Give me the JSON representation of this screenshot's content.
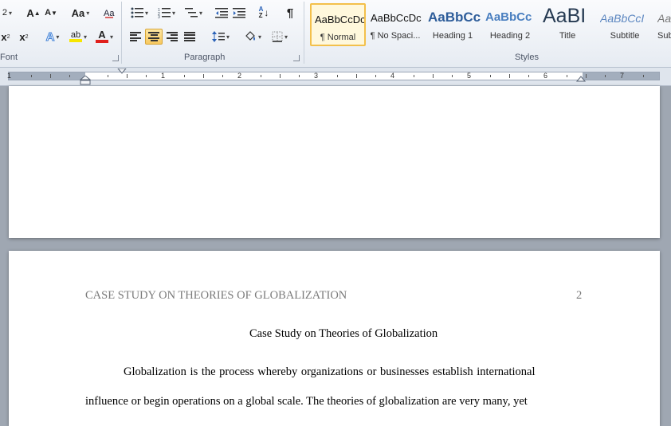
{
  "ribbon": {
    "font_group": {
      "label": "Font",
      "size_value": "2",
      "grow_font": "A",
      "shrink_font": "A",
      "change_case": "Aa",
      "subscript": "x",
      "superscript": "x",
      "font_color_letter": "A",
      "highlight_letters": "ab",
      "text_effects_letter": "A"
    },
    "paragraph_group": {
      "label": "Paragraph",
      "pilcrow": "¶",
      "sort_top": "A",
      "sort_bottom": "Z"
    },
    "styles_group": {
      "label": "Styles",
      "styles": [
        {
          "sample": "AaBbCcDc",
          "name": "¶ Normal",
          "selected": true
        },
        {
          "sample": "AaBbCcDc",
          "name": "¶ No Spaci...",
          "selected": false
        },
        {
          "sample": "AaBbCc",
          "name": "Heading 1",
          "selected": false
        },
        {
          "sample": "AaBbCc",
          "name": "Heading 2",
          "selected": false
        },
        {
          "sample": "AaBI",
          "name": "Title",
          "selected": false
        },
        {
          "sample": "AaBbCcI",
          "name": "Subtitle",
          "selected": false
        },
        {
          "sample": "Aa",
          "name": "Sub",
          "selected": false
        }
      ]
    }
  },
  "ruler": {
    "numbers": [
      "1",
      "1",
      "2",
      "3",
      "4",
      "5",
      "6",
      "7"
    ]
  },
  "document": {
    "running_head": "CASE STUDY ON THEORIES OF GLOBALIZATION",
    "page_number": "2",
    "title": "Case Study on Theories of Globalization",
    "para_line1": "Globalization is the process whereby organizations or businesses establish international",
    "para_line2": "influence or begin operations on a global scale. The theories of globalization are very many, yet"
  },
  "colors": {
    "accent_selected": "#f3c04b",
    "font_color": "#e0201c",
    "highlight": "#f7e600",
    "text_effects": "#3d7fd6"
  }
}
